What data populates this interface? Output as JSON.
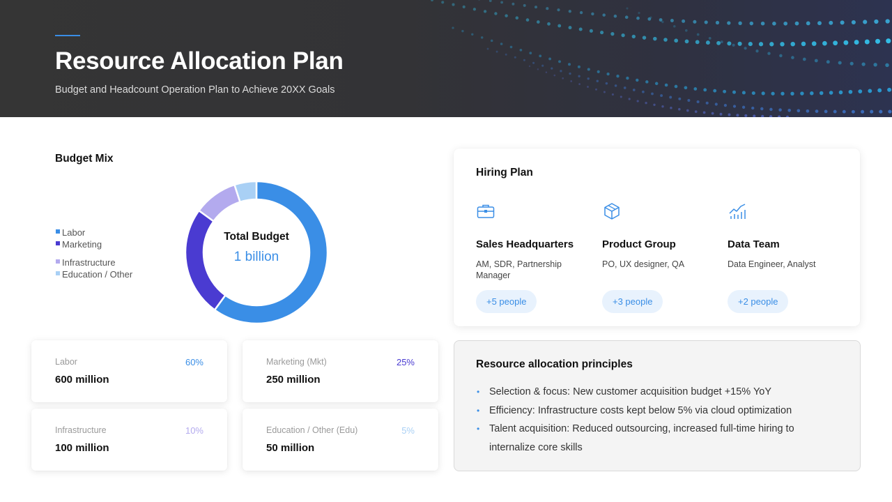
{
  "header": {
    "title": "Resource Allocation Plan",
    "subtitle": "Budget and Headcount Operation Plan to Achieve 20XX Goals",
    "accent_color": "#3a8ee6"
  },
  "budget_mix": {
    "title": "Budget Mix",
    "center_label": "Total Budget",
    "center_value": "1 billion",
    "legend": [
      {
        "label": "Labor",
        "color": "#3a8ee6"
      },
      {
        "label": "Marketing",
        "color": "#4a3bd1"
      },
      {
        "label": "Infrastructure",
        "color": "#b3aaee"
      },
      {
        "label": "Education / Other",
        "color": "#a9d0f5"
      }
    ],
    "cards": [
      {
        "label": "Labor",
        "percent": "60%",
        "value": "600 million",
        "color": "#3a8ee6"
      },
      {
        "label": "Marketing (Mkt)",
        "percent": "25%",
        "value": "250 million",
        "color": "#4a3bd1"
      },
      {
        "label": "Infrastructure",
        "percent": "10%",
        "value": "100 million",
        "color": "#b3aaee"
      },
      {
        "label": "Education / Other (Edu)",
        "percent": "5%",
        "value": "50 million",
        "color": "#a9d0f5"
      }
    ]
  },
  "chart_data": {
    "type": "pie",
    "categories": [
      "Labor",
      "Marketing",
      "Infrastructure",
      "Education / Other"
    ],
    "values": [
      60,
      25,
      10,
      5
    ],
    "colors": [
      "#3a8ee6",
      "#4a3bd1",
      "#b3aaee",
      "#a9d0f5"
    ],
    "title": "Budget Mix",
    "legend_position": "left"
  },
  "hiring": {
    "title": "Hiring Plan",
    "teams": [
      {
        "name": "Sales Headquarters",
        "roles": "AM, SDR, Partnership Manager",
        "count": "+5 people",
        "icon": "briefcase-icon"
      },
      {
        "name": "Product Group",
        "roles": "PO, UX designer, QA",
        "count": "+3 people",
        "icon": "cube-icon"
      },
      {
        "name": "Data Team",
        "roles": "Data Engineer, Analyst",
        "count": "+2 people",
        "icon": "chart-icon"
      }
    ]
  },
  "principles": {
    "title": "Resource allocation principles",
    "items": [
      "Selection & focus: New customer acquisition budget +15% YoY",
      "Efficiency: Infrastructure costs kept below 5% via cloud optimization",
      "Talent acquisition: Reduced outsourcing, increased full-time hiring to internalize core skills"
    ]
  }
}
